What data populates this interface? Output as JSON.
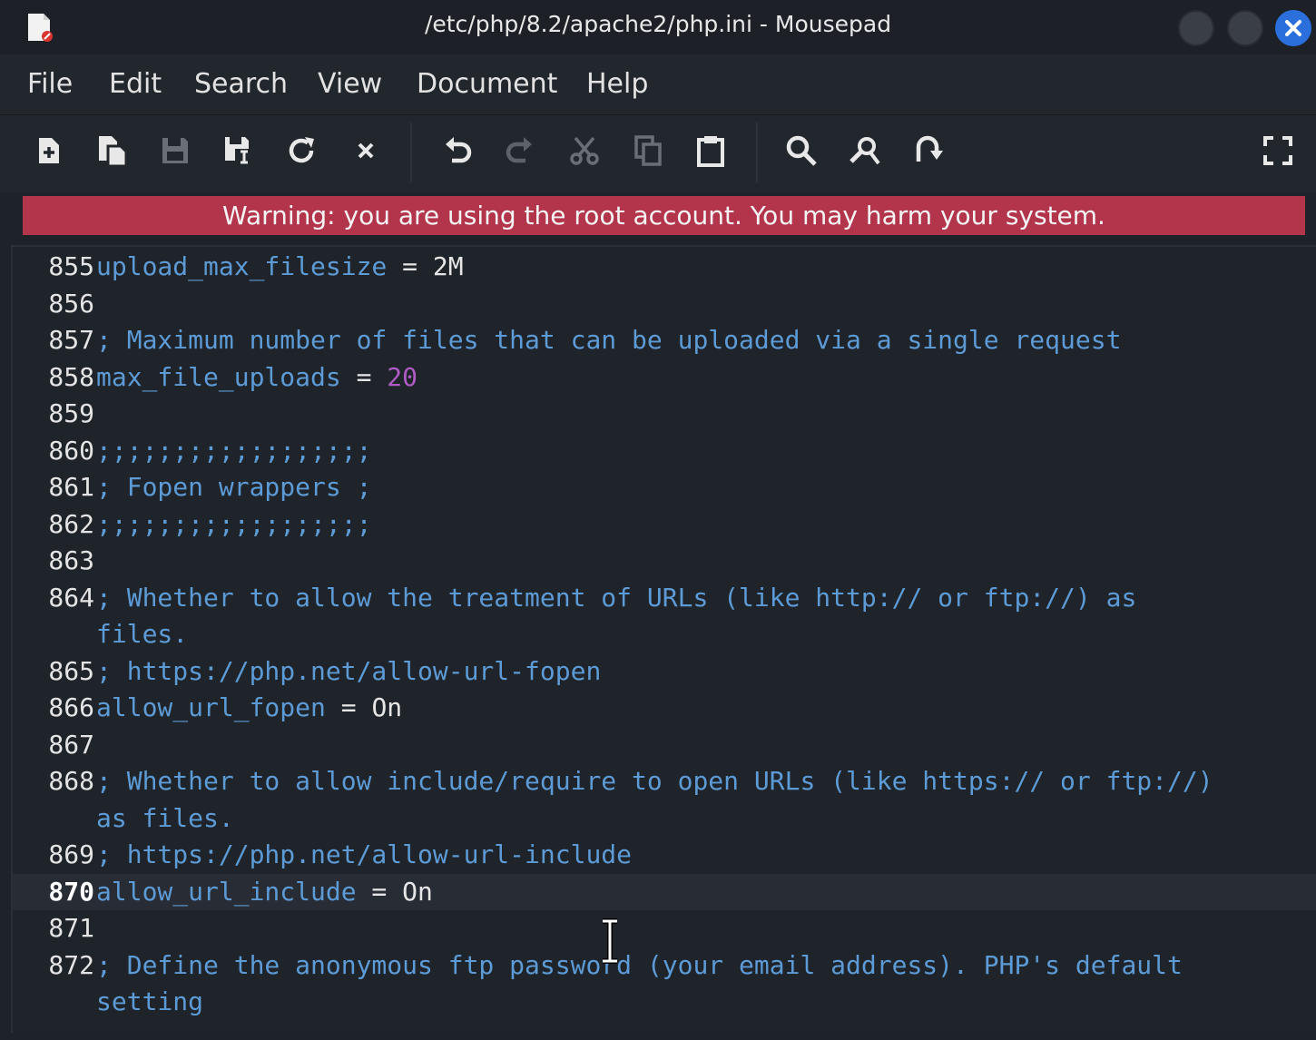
{
  "window": {
    "title": "/etc/php/8.2/apache2/php.ini - Mousepad",
    "icons": {
      "app": "text-editor-icon",
      "minimize": "minimize-icon",
      "maximize": "maximize-icon",
      "close": "close-icon"
    }
  },
  "menubar": {
    "items": [
      "File",
      "Edit",
      "Search",
      "View",
      "Document",
      "Help"
    ]
  },
  "toolbar": {
    "buttons": [
      {
        "icon": "new-document-icon",
        "enabled": true
      },
      {
        "icon": "new-window-icon",
        "enabled": true
      },
      {
        "icon": "save-icon",
        "enabled": false
      },
      {
        "icon": "save-as-icon",
        "enabled": true
      },
      {
        "icon": "reload-icon",
        "enabled": true
      },
      {
        "icon": "close-tab-icon",
        "enabled": true
      },
      {
        "icon": "undo-icon",
        "enabled": true
      },
      {
        "icon": "redo-icon",
        "enabled": false
      },
      {
        "icon": "cut-icon",
        "enabled": false
      },
      {
        "icon": "copy-icon",
        "enabled": false
      },
      {
        "icon": "paste-icon",
        "enabled": true
      },
      {
        "icon": "find-icon",
        "enabled": true
      },
      {
        "icon": "find-replace-icon",
        "enabled": true
      },
      {
        "icon": "go-to-line-icon",
        "enabled": true
      },
      {
        "icon": "fullscreen-icon",
        "enabled": true
      }
    ]
  },
  "warning": {
    "text": "Warning: you are using the root account. You may harm your system."
  },
  "editor": {
    "colors": {
      "comment": "#5d9bd6",
      "key": "#5d9bd6",
      "number": "#b05cc4",
      "text": "#e6e6e6"
    },
    "current_line": 870,
    "lines": [
      {
        "num": "855",
        "key": "upload_max_filesize",
        "op": " = ",
        "val": "2M"
      },
      {
        "num": "856"
      },
      {
        "num": "857",
        "comment": "; Maximum number of files that can be uploaded via a single request"
      },
      {
        "num": "858",
        "key": "max_file_uploads",
        "op": " = ",
        "num_val": "20"
      },
      {
        "num": "859"
      },
      {
        "num": "860",
        "comment": ";;;;;;;;;;;;;;;;;;"
      },
      {
        "num": "861",
        "comment": "; Fopen wrappers ;"
      },
      {
        "num": "862",
        "comment": ";;;;;;;;;;;;;;;;;;"
      },
      {
        "num": "863"
      },
      {
        "num": "864",
        "comment": "; Whether to allow the treatment of URLs (like http:// or ftp://) as",
        "wrap": "files."
      },
      {
        "num": "865",
        "comment": "; https://php.net/allow-url-fopen"
      },
      {
        "num": "866",
        "key": "allow_url_fopen",
        "op": " = ",
        "val": "On"
      },
      {
        "num": "867"
      },
      {
        "num": "868",
        "comment": "; Whether to allow include/require to open URLs (like https:// or ftp://)",
        "wrap": "as files."
      },
      {
        "num": "869",
        "comment": "; https://php.net/allow-url-include"
      },
      {
        "num": "870",
        "key": "allow_url_include",
        "op": " = ",
        "val": "On"
      },
      {
        "num": "871"
      },
      {
        "num": "872",
        "comment": "; Define the anonymous ftp password (your email address). PHP's default",
        "wrap": "setting"
      }
    ]
  },
  "mouse_cursor": "i-beam-cursor-icon"
}
